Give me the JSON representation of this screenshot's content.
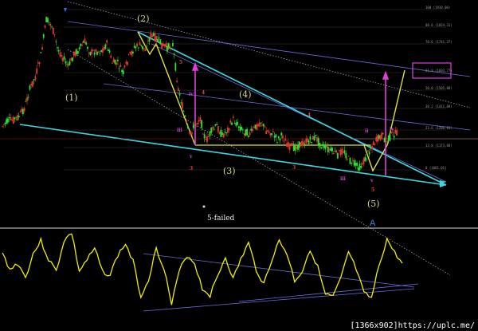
{
  "chart_data": {
    "type": "candlestick with oscillator",
    "wave_labels": [
      "(2)",
      "(1)",
      "(4)",
      "(3)",
      "(5)"
    ],
    "sub_labels": [
      "iii",
      "iv",
      "v",
      "ii",
      "iii",
      "iv",
      "v",
      "3",
      "4",
      "5",
      "3",
      "4",
      "5"
    ],
    "fib_levels": [
      "100 (1919.00)",
      "88.6 (1824.31)",
      "78.6 (1741.37)",
      "61.8 (1603.77)",
      "50.0 (1505.88)",
      "38.2 (1411.09)",
      "23.6 (1286.83)",
      "13.8 (1173.88)",
      "0 (1061.01)"
    ],
    "annotations": {
      "failed_fifth": "5-failed",
      "point_a": "A"
    },
    "price_series": [
      158,
      152,
      150,
      146,
      136,
      112,
      96,
      70,
      25,
      32,
      60,
      72,
      84,
      68,
      62,
      52,
      66,
      64,
      64,
      55,
      78,
      80,
      92,
      72,
      60,
      57,
      62,
      44,
      48,
      56,
      60,
      56,
      112,
      140,
      170,
      156,
      148,
      178,
      165,
      158,
      170,
      162,
      150,
      158,
      165,
      168,
      160,
      152,
      164,
      166,
      175,
      170,
      183,
      185,
      182,
      178,
      176,
      172,
      182,
      186,
      190,
      194,
      188,
      200,
      206,
      210,
      200,
      185,
      176,
      170,
      176,
      168,
      167
    ],
    "oscillator_series": [
      318,
      338,
      330,
      348,
      318,
      302,
      325,
      340,
      302,
      292,
      340,
      326,
      312,
      340,
      345,
      320,
      306,
      328,
      372,
      350,
      312,
      335,
      382,
      340,
      320,
      330,
      362,
      370,
      346,
      322,
      350,
      325,
      305,
      338,
      356,
      326,
      302,
      318,
      352,
      340,
      312,
      335,
      370,
      372,
      350,
      316,
      338,
      368,
      374,
      332,
      300,
      317,
      330
    ]
  }
}
